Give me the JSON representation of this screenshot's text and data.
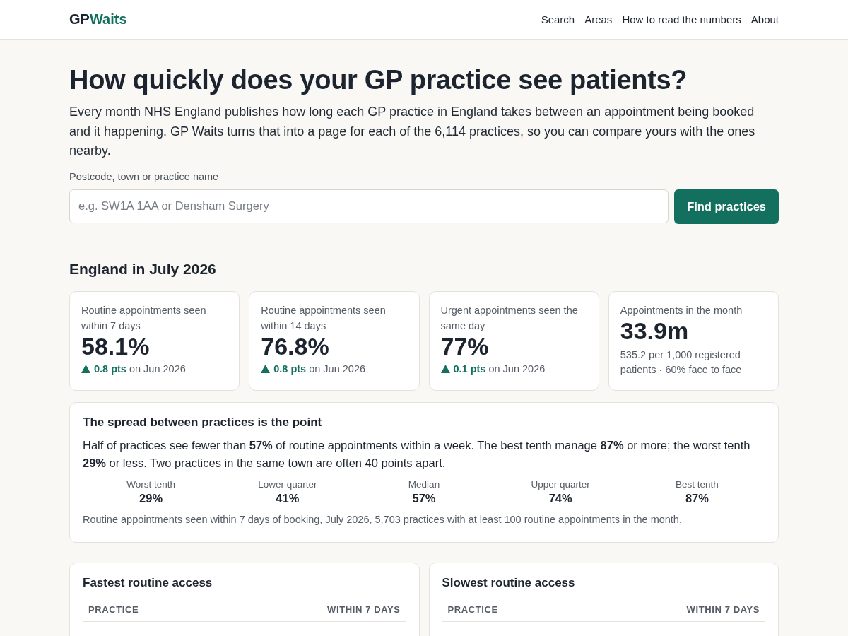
{
  "header": {
    "logo": {
      "first": "GP",
      "second": "Waits"
    },
    "nav": [
      {
        "label": "Search"
      },
      {
        "label": "Areas"
      },
      {
        "label": "How to read the numbers"
      },
      {
        "label": "About"
      }
    ]
  },
  "hero": {
    "title": "How quickly does your GP practice see patients?",
    "intro": "Every month NHS England publishes how long each GP practice in England takes between an appointment being booked and it happening. GP Waits turns that into a page for each of the 6,114 practices, so you can compare yours with the ones nearby.",
    "search": {
      "label": "Postcode, town or practice name",
      "placeholder": "e.g. SW1A 1AA or Densham Surgery",
      "button": "Find practices"
    }
  },
  "summary": {
    "title": "England in July 2026",
    "cards": [
      {
        "kind": "change",
        "label": "Routine appointments seen within 7 days",
        "value": "58.1%",
        "change": {
          "rising": true,
          "text": "**0.8 pts** on Jun 2026"
        }
      },
      {
        "kind": "change",
        "label": "Routine appointments seen within 14 days",
        "value": "76.8%",
        "change": {
          "rising": true,
          "text": "**0.8 pts** on Jun 2026"
        }
      },
      {
        "kind": "change",
        "label": "Urgent appointments seen the same day",
        "value": "77%",
        "change": {
          "rising": true,
          "text": "**0.1 pts** on Jun 2026"
        }
      },
      {
        "kind": "note",
        "label": "Appointments in the month",
        "value": "33.9m",
        "note": "535.2 per 1,000 registered patients · 60% face to face"
      }
    ]
  },
  "spread": {
    "title": "The spread between practices is the point",
    "text": "Half of practices see fewer than **57%** of routine appointments within a week. The best tenth manage **87%** or more; the worst tenth **29%** or less. Two practices in the same town are often 40 points apart.",
    "percentiles": [
      {
        "label": "Worst tenth",
        "value": "29%"
      },
      {
        "label": "Lower quarter",
        "value": "41%"
      },
      {
        "label": "Median",
        "value": "57%"
      },
      {
        "label": "Upper quarter",
        "value": "74%"
      },
      {
        "label": "Best tenth",
        "value": "87%"
      }
    ],
    "footnote": "Routine appointments seen within 7 days of booking, July 2026, 5,703 practices with at least 100 routine appointments in the month."
  },
  "tables": [
    {
      "title": "Fastest routine access",
      "columns": [
        "PRACTICE",
        "WITHIN 7 DAYS"
      ]
    },
    {
      "title": "Slowest routine access",
      "columns": [
        "PRACTICE",
        "WITHIN 7 DAYS"
      ]
    }
  ]
}
